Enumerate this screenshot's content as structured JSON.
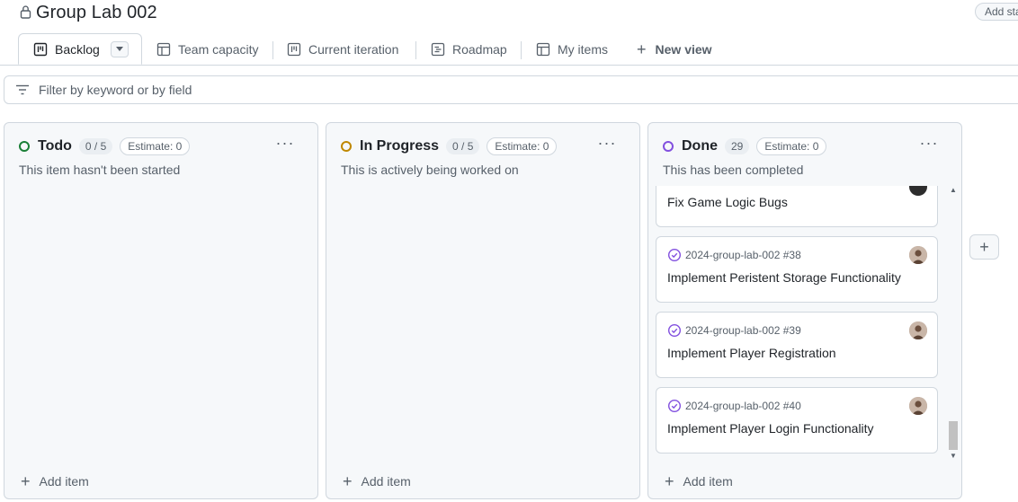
{
  "project": {
    "title": "Group Lab 002",
    "add_status": "Add sta"
  },
  "tabs": [
    {
      "label": "Backlog",
      "icon": "board-icon"
    },
    {
      "label": "Team capacity",
      "icon": "table-icon"
    },
    {
      "label": "Current iteration",
      "icon": "board-icon"
    },
    {
      "label": "Roadmap",
      "icon": "roadmap-icon"
    },
    {
      "label": "My items",
      "icon": "table-icon"
    },
    {
      "label": "New view",
      "icon": "plus-icon"
    }
  ],
  "filter": {
    "placeholder": "Filter by keyword or by field"
  },
  "columns": [
    {
      "name": "Todo",
      "count": "0 / 5",
      "estimate": "Estimate: 0",
      "description": "This item hasn't been started",
      "color": "#1a7f37",
      "add_item": "Add item"
    },
    {
      "name": "In Progress",
      "count": "0 / 5",
      "estimate": "Estimate: 0",
      "description": "This is actively being worked on",
      "color": "#bf8700",
      "add_item": "Add item"
    },
    {
      "name": "Done",
      "count": "29",
      "estimate": "Estimate: 0",
      "description": "This has been completed",
      "color": "#8250df",
      "add_item": "Add item",
      "cards": [
        {
          "ref": "",
          "title": "Fix Game Logic Bugs"
        },
        {
          "ref": "2024-group-lab-002 #38",
          "title": "Implement Peristent Storage Functionality"
        },
        {
          "ref": "2024-group-lab-002 #39",
          "title": "Implement Player Registration"
        },
        {
          "ref": "2024-group-lab-002 #40",
          "title": "Implement Player Login Functionality"
        }
      ]
    }
  ],
  "colors": {
    "done_icon": "#8250df",
    "border": "#d0d7de",
    "muted": "#57606a"
  }
}
